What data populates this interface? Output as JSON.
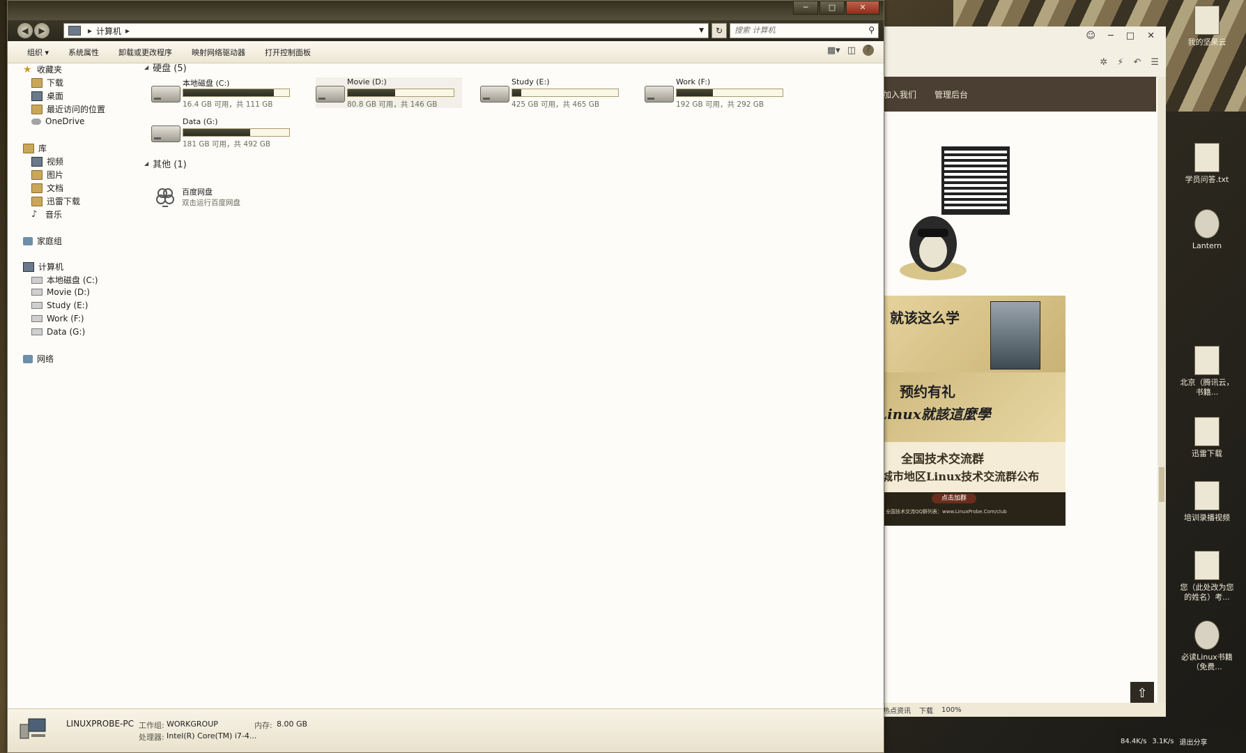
{
  "window": {
    "controls": {
      "minimize": "─",
      "maximize": "□",
      "close": "✕"
    },
    "address": {
      "location": "计算机"
    },
    "search": {
      "placeholder": "搜索 计算机"
    }
  },
  "toolbar": {
    "items": [
      "组织 ▾",
      "系统属性",
      "卸载或更改程序",
      "映射网络驱动器",
      "打开控制面板"
    ]
  },
  "navpane": {
    "favorites": {
      "label": "收藏夹",
      "items": [
        "下载",
        "桌面",
        "最近访问的位置",
        "OneDrive"
      ]
    },
    "libraries": {
      "label": "库",
      "items": [
        "视频",
        "图片",
        "文档",
        "迅雷下载",
        "音乐"
      ]
    },
    "homegroup": "家庭组",
    "computer": {
      "label": "计算机",
      "items": [
        "本地磁盘 (C:)",
        "Movie (D:)",
        "Study (E:)",
        "Work (F:)",
        "Data (G:)"
      ]
    },
    "network": "网络"
  },
  "content": {
    "hard_disks_header": "硬盘 (5)",
    "others_header": "其他 (1)",
    "drives": [
      {
        "name": "本地磁盘 (C:)",
        "free": "16.4 GB 可用，共 111 GB",
        "used_fraction": 0.852
      },
      {
        "name": "Movie (D:)",
        "free": "80.8 GB 可用，共 146 GB",
        "used_fraction": 0.447
      },
      {
        "name": "Study (E:)",
        "free": "425 GB 可用，共 465 GB",
        "used_fraction": 0.086
      },
      {
        "name": "Work (F:)",
        "free": "192 GB 可用，共 292 GB",
        "used_fraction": 0.342
      },
      {
        "name": "Data (G:)",
        "free": "181 GB 可用，共 492 GB",
        "used_fraction": 0.632
      }
    ],
    "app": {
      "name": "百度网盘",
      "desc": "双击运行百度网盘"
    }
  },
  "details": {
    "pc_name": "LINUXPROBE-PC",
    "workgroup_label": "工作组:",
    "workgroup": "WORKGROUP",
    "memory_label": "内存:",
    "memory": "8.00 GB",
    "cpu_label": "处理器:",
    "cpu": "Intel(R) Core(TM) i7-4..."
  },
  "browser": {
    "nav": [
      "加入我们",
      "管理后台"
    ],
    "banner1": "就该这么学",
    "banner2a": "预约有礼",
    "banner2b": "Linux就該這麼學",
    "banner3a": "全国技术交流群",
    "banner3b": "城市地区Linux技术交流群公布",
    "banner3_btn": "点击加群",
    "banner3_small": "全国技术交流QQ群列表：www.LinuxProbe.Com/club",
    "status": [
      "热点资讯",
      "下载",
      "100%"
    ]
  },
  "desktop_icons": [
    {
      "label": "我的坚果云"
    },
    {
      "label": "学员问答.txt"
    },
    {
      "label": "Lantern"
    },
    {
      "label": "北京（腾讯云，书籍..."
    },
    {
      "label": "迅雷下载"
    },
    {
      "label": "培训录播视频"
    },
    {
      "label": "您（此处改为您的姓名）考..."
    },
    {
      "label": "必读Linux书籍（免费..."
    }
  ],
  "taskbar": {
    "net_up": "84.4K/s",
    "net_down": "3.1K/s",
    "share": "退出分享"
  }
}
